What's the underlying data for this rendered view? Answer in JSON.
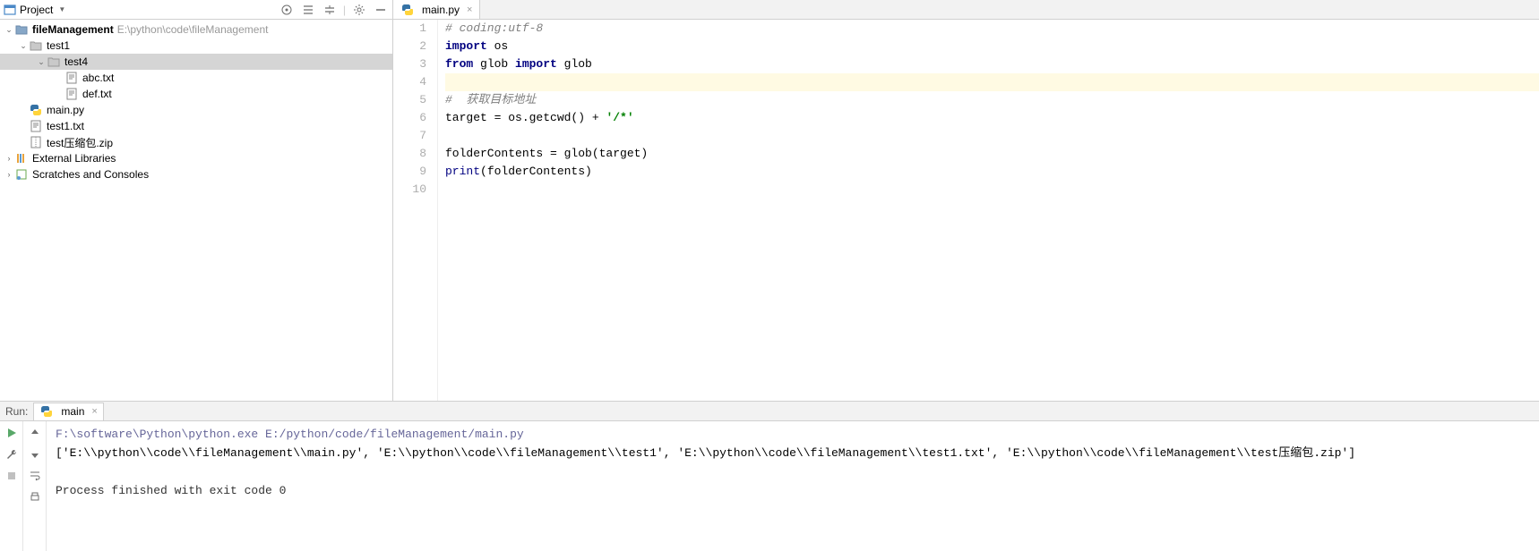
{
  "sidebar": {
    "title": "Project",
    "project": {
      "name": "fileManagement",
      "path": "E:\\python\\code\\fileManagement"
    },
    "tree": {
      "folder_test1": "test1",
      "folder_test4": "test4",
      "file_abc": "abc.txt",
      "file_def": "def.txt",
      "file_main": "main.py",
      "file_test1txt": "test1.txt",
      "file_zip": "test压缩包.zip",
      "ext_libs": "External Libraries",
      "scratches": "Scratches and Consoles"
    }
  },
  "editor": {
    "tab": {
      "label": "main.py"
    },
    "lines": [
      "1",
      "2",
      "3",
      "4",
      "5",
      "6",
      "7",
      "8",
      "9",
      "10"
    ],
    "code": {
      "l1_comment": "# coding:utf-8",
      "l2_import": "import",
      "l2_os": " os",
      "l3_from": "from",
      "l3_glob1": " glob ",
      "l3_import": "import",
      "l3_glob2": " glob",
      "l5_comment": "#  获取目标地址",
      "l6_a": "target = os.getcwd() + ",
      "l6_str": "'/*'",
      "l8": "folderContents = glob(target)",
      "l9_a": "print",
      "l9_b": "(folderContents)"
    }
  },
  "run": {
    "label": "Run:",
    "tab": "main",
    "cmd": "F:\\software\\Python\\python.exe E:/python/code/fileManagement/main.py",
    "output": "['E:\\\\python\\\\code\\\\fileManagement\\\\main.py', 'E:\\\\python\\\\code\\\\fileManagement\\\\test1', 'E:\\\\python\\\\code\\\\fileManagement\\\\test1.txt', 'E:\\\\python\\\\code\\\\fileManagement\\\\test压缩包.zip']",
    "exit": "Process finished with exit code 0"
  }
}
